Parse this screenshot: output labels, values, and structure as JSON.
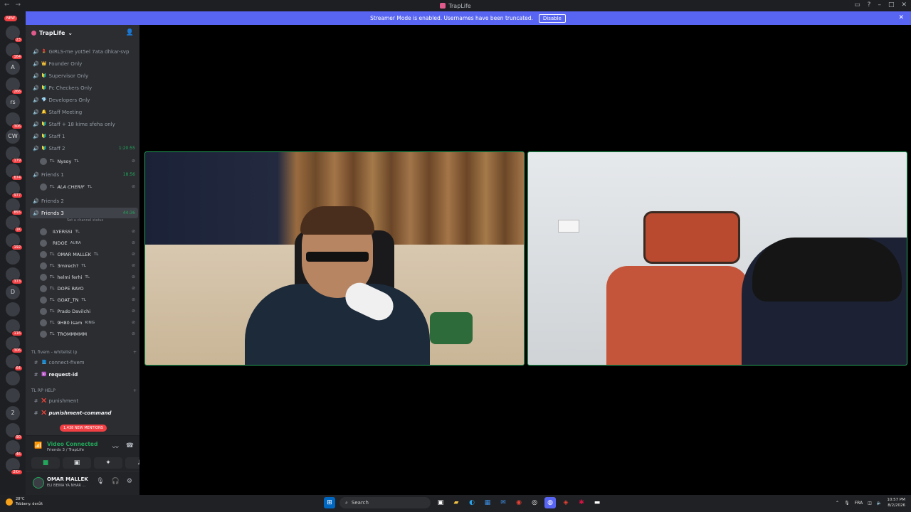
{
  "window": {
    "title": "TrapLife"
  },
  "banner": {
    "message": "Streamer Mode is enabled. Usernames have been truncated.",
    "disable_label": "Disable"
  },
  "servers": {
    "new_label": "NEW",
    "items": [
      {
        "label": "",
        "badge": "23"
      },
      {
        "label": "",
        "badge": "164"
      },
      {
        "label": "A",
        "badge": ""
      },
      {
        "label": "",
        "badge": "266"
      },
      {
        "label": "rs",
        "badge": ""
      },
      {
        "label": "",
        "badge": "306"
      },
      {
        "label": "CW",
        "badge": ""
      },
      {
        "label": "",
        "badge": "179"
      },
      {
        "label": "",
        "badge": "674"
      },
      {
        "label": "",
        "badge": "977"
      },
      {
        "label": "",
        "badge": "855"
      },
      {
        "label": "",
        "badge": "1K"
      },
      {
        "label": "",
        "badge": "192"
      },
      {
        "label": "",
        "badge": ""
      },
      {
        "label": "",
        "badge": "373"
      },
      {
        "label": "D",
        "badge": ""
      },
      {
        "label": "",
        "badge": ""
      },
      {
        "label": "",
        "badge": "116"
      },
      {
        "label": "",
        "badge": "306"
      },
      {
        "label": "",
        "badge": "64"
      },
      {
        "label": "",
        "badge": ""
      },
      {
        "label": "",
        "badge": ""
      },
      {
        "label": "2",
        "badge": ""
      },
      {
        "label": "",
        "badge": "90"
      },
      {
        "label": "",
        "badge": "46"
      },
      {
        "label": "",
        "badge": "2K+"
      }
    ]
  },
  "sidebar": {
    "guild_name": "TrapLife",
    "channels": [
      {
        "emoji": "💄",
        "name": "GIRLS-me yot5el 7ata dhkar-svp",
        "timer": "",
        "type": "voice"
      },
      {
        "emoji": "👑",
        "name": "Founder Only",
        "timer": "",
        "type": "voice"
      },
      {
        "emoji": "🔰",
        "name": "Supervisor Only",
        "timer": "",
        "type": "voice"
      },
      {
        "emoji": "🔰",
        "name": "Pc Checkers Only",
        "timer": "",
        "type": "voice"
      },
      {
        "emoji": "💎",
        "name": "Developers Only",
        "timer": "",
        "type": "voice"
      },
      {
        "emoji": "🔔",
        "name": "Staff Meeting",
        "timer": "",
        "type": "voice"
      },
      {
        "emoji": "🔰",
        "name": "Staff + 18 kime sfeha only",
        "timer": "",
        "type": "voice"
      },
      {
        "emoji": "🔰",
        "name": "Staff 1",
        "timer": "",
        "type": "voice"
      },
      {
        "emoji": "🔰",
        "name": "Staff 2",
        "timer": "1:20:55",
        "type": "voice"
      }
    ],
    "staff2_user": {
      "tag": "TL",
      "name": "Nysoy",
      "badge": "TL"
    },
    "friends1": {
      "name": "Friends 1",
      "timer": "18:56"
    },
    "friends1_user": {
      "tag": "TL",
      "name": "ALA CHERIF",
      "badge": "TL"
    },
    "friends2": {
      "name": "Friends 2"
    },
    "friends3": {
      "name": "Friends 3",
      "timer": "44:36",
      "status_hint": "Set a channel status"
    },
    "friends3_users": [
      {
        "tag": "",
        "name": "ILYERSSI",
        "badge": "TL"
      },
      {
        "tag": "",
        "name": "RIDOE",
        "badge": "AURA"
      },
      {
        "tag": "TL",
        "name": "OMAR MALLEK",
        "badge": "TL"
      },
      {
        "tag": "TL",
        "name": "3mirech?",
        "badge": "TL"
      },
      {
        "tag": "TL",
        "name": "helmi ferhi",
        "badge": "TL"
      },
      {
        "tag": "TL",
        "name": "DOPE RAYO",
        "badge": ""
      },
      {
        "tag": "TL",
        "name": "GOAT_TN",
        "badge": "TL"
      },
      {
        "tag": "TL",
        "name": "Prado Davilchi",
        "badge": ""
      },
      {
        "tag": "TL",
        "name": "9H80 Isam",
        "badge": "KING"
      },
      {
        "tag": "TL",
        "name": "TROMMMMM",
        "badge": ""
      }
    ],
    "category_fivem": "TL fivem - whitelist ip",
    "fivem_channels": [
      {
        "emoji": "📘",
        "name": "connect-fivem"
      },
      {
        "emoji": "🆔",
        "name": "request-id"
      }
    ],
    "category_help": "TL RP HELP",
    "help_channels": [
      {
        "emoji": "❌",
        "name": "punishment"
      },
      {
        "emoji": "❌",
        "name": "punishment-command"
      }
    ],
    "mentions_label": "1,438 NEW MENTIONS"
  },
  "voice_panel": {
    "status": "Video Connected",
    "location": "Friends 3 / TrapLife"
  },
  "user_panel": {
    "name": "OMAR MALLEK",
    "status": "ELI BEINA YA NHAR ..."
  },
  "taskbar": {
    "weather_temp": "28°C",
    "weather_desc": "Tebbeny. derűlt",
    "search_label": "Search",
    "lang": "FRA",
    "time": "10:57 PM",
    "date": "8/2/2026"
  }
}
